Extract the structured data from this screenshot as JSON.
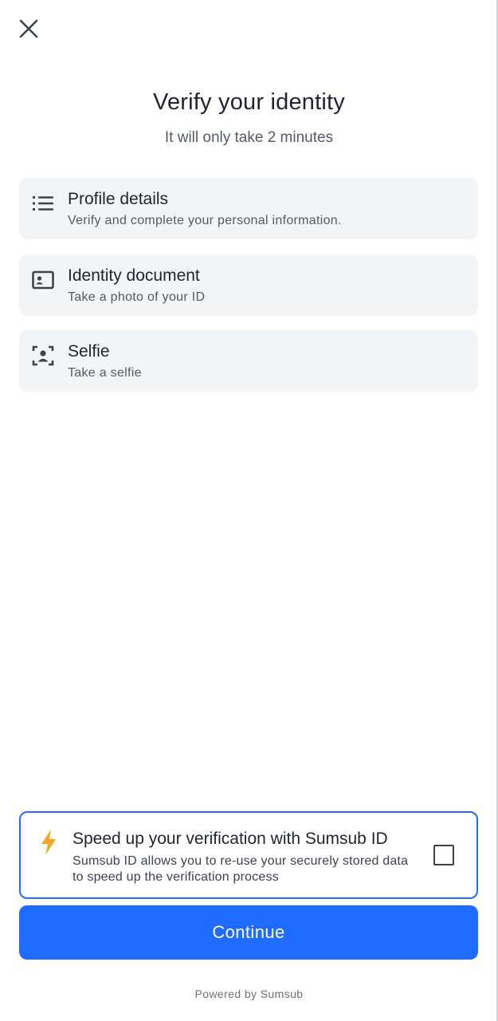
{
  "header": {
    "close_icon": "close-icon"
  },
  "intro": {
    "title": "Verify your identity",
    "subtitle": "It will only take 2 minutes"
  },
  "steps": [
    {
      "icon": "list-icon",
      "title": "Profile details",
      "description": "Verify and complete your personal information."
    },
    {
      "icon": "id-card-icon",
      "title": "Identity document",
      "description": "Take a photo of your ID"
    },
    {
      "icon": "face-scan-icon",
      "title": "Selfie",
      "description": "Take a selfie"
    }
  ],
  "sumsub_id": {
    "icon": "lightning-icon",
    "title": "Speed up your verification with Sumsub ID",
    "description": "Sumsub ID allows you to re-use your securely stored data to speed up the verification process",
    "checked": false
  },
  "actions": {
    "continue_label": "Continue"
  },
  "footer": {
    "powered_by": "Powered by Sumsub"
  },
  "colors": {
    "accent": "#1f6bff",
    "card_background": "#f3f4f5",
    "lightning": "#f5a623",
    "text_primary": "#1f2430",
    "text_secondary": "#545a66"
  }
}
